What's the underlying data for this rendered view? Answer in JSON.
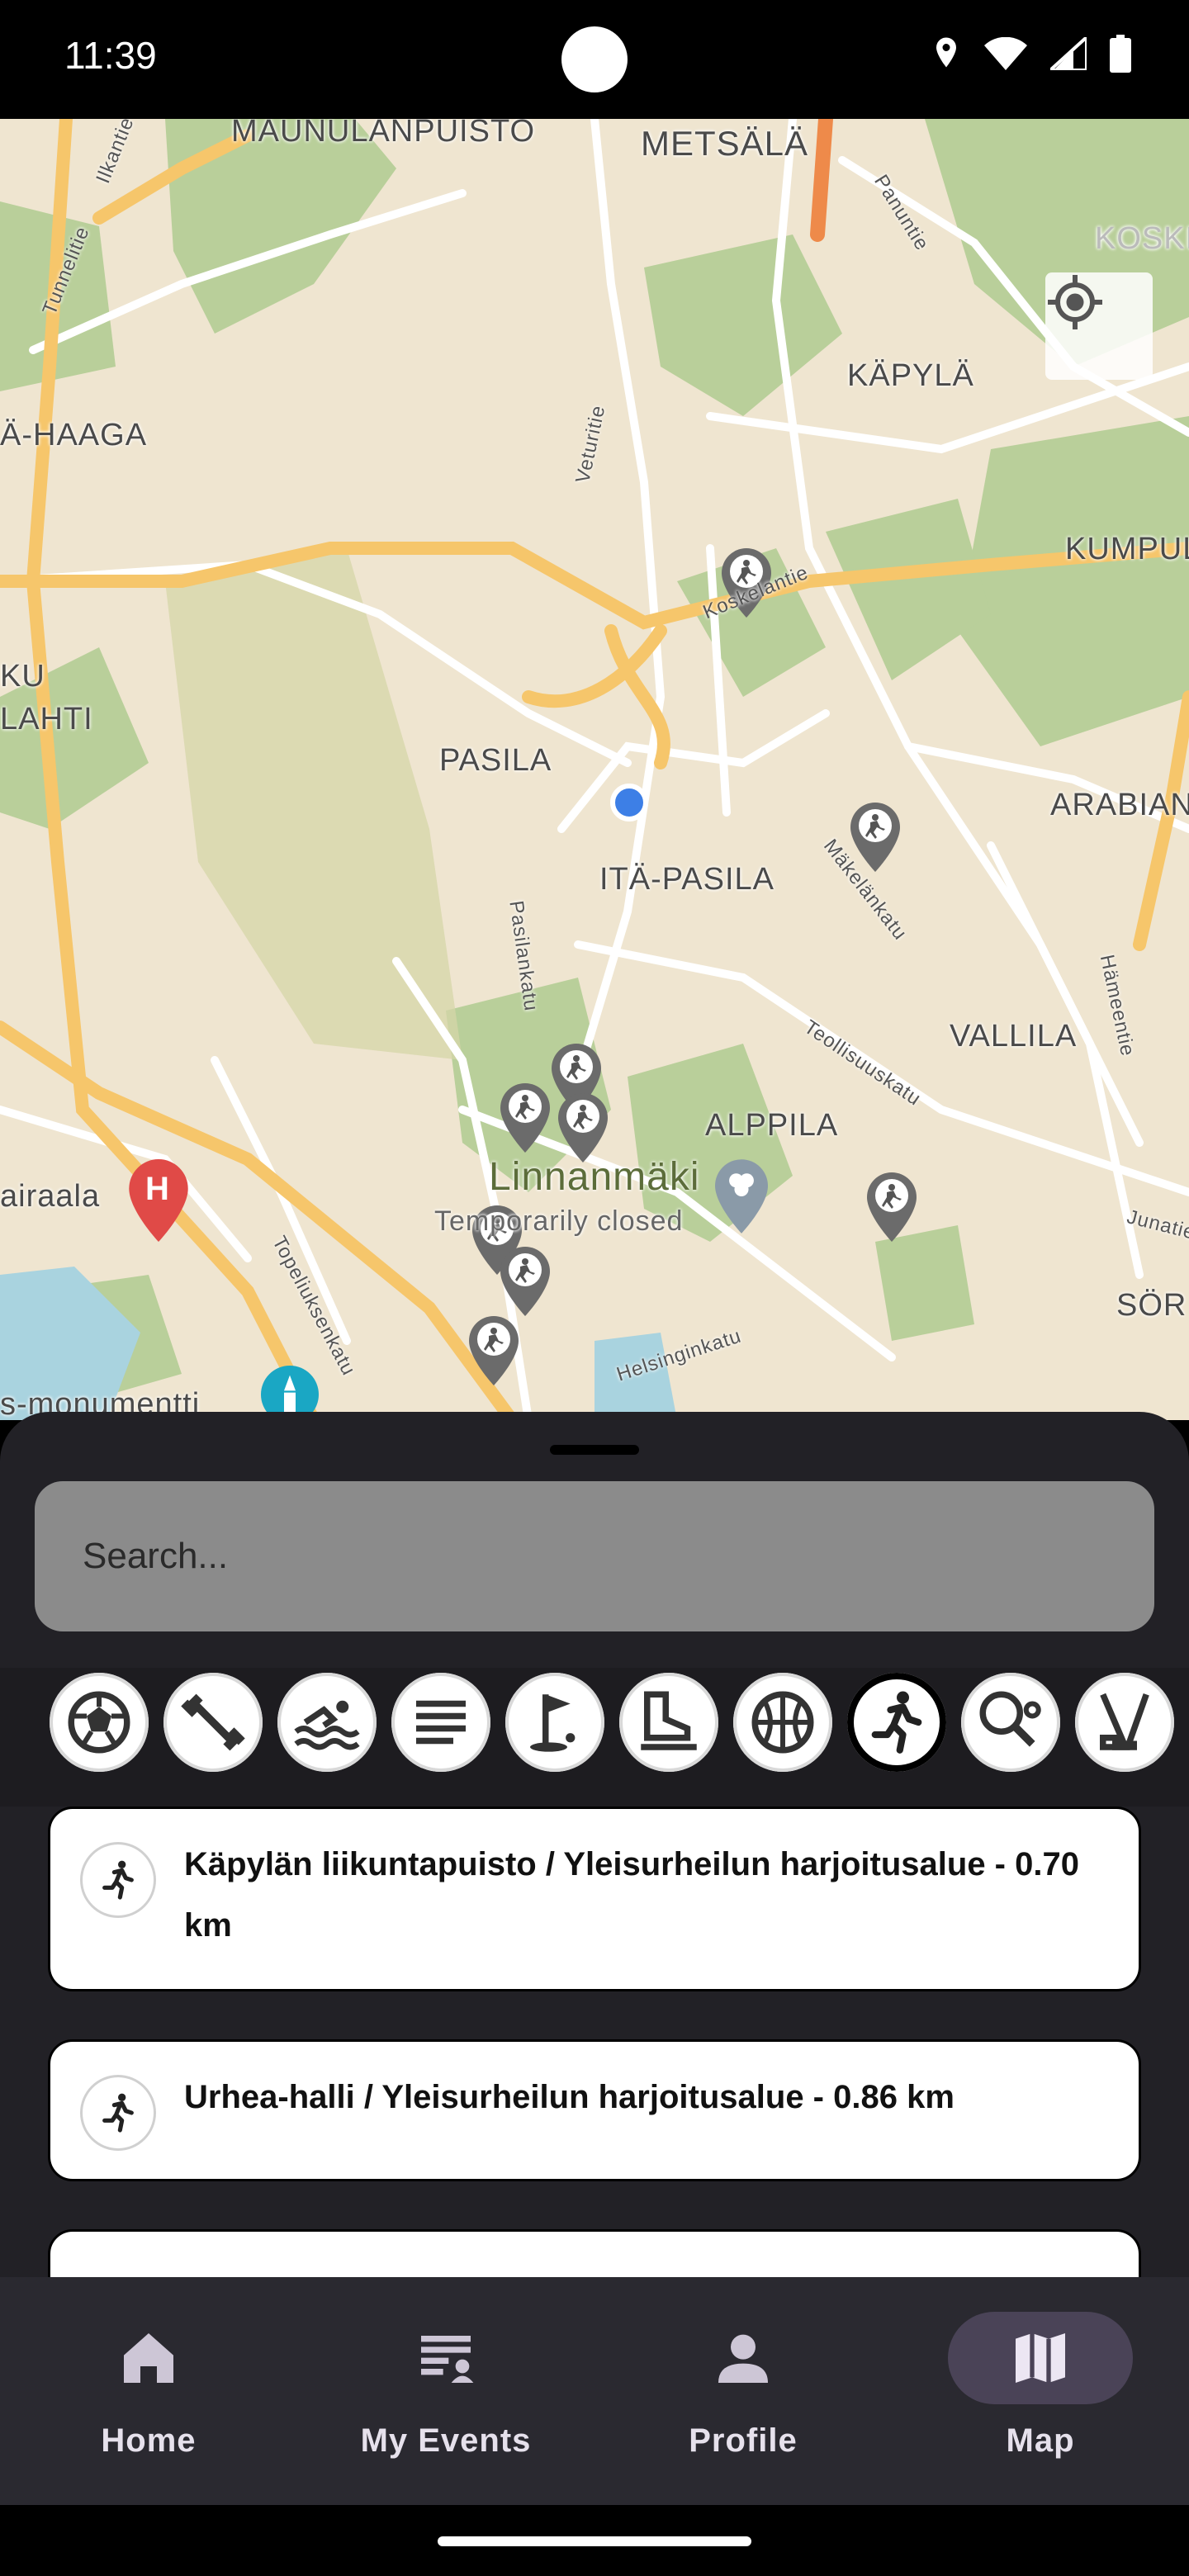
{
  "status_bar": {
    "time": "11:39"
  },
  "map": {
    "labels": {
      "maunulanpuisto": "MAUNULANPUISTO",
      "metsala": "METSÄLÄ",
      "kapyla": "KÄPYLÄ",
      "haaga": "Ä-HAAGA",
      "kumpula": "KUMPUL",
      "pasila": "PASILA",
      "ita_pasila": "ITÄ-PASILA",
      "arabia": "ARABIAN",
      "vallila": "VALLILA",
      "alppila": "ALPPILA",
      "linnanmaki": "Linnanmäki",
      "temporarily_closed": "Temporarily closed",
      "koski": "KOSKI",
      "ku": "KU",
      "lahti": "LAHTI",
      "sorn": "SÖR",
      "airaala": "airaala",
      "monumentti": "s-monumentti",
      "veturitie": "Veturitie",
      "pasilankatu": "Pasilankatu",
      "koskelantie": "Koskelantie",
      "makelankatu": "Mäkelänkatu",
      "teollisuuskatu": "Teollisuuskatu",
      "hameentie": "Hämeentie",
      "helsinginkatu": "Helsinginkatu",
      "topeliuksenkatu": "Topeliuksenkatu",
      "tunnelitie": "Tunnelitie",
      "ilkantie": "Ilkantie",
      "panuntie": "Panuntie",
      "junatie": "Junatie"
    },
    "hospital_letter": "H"
  },
  "search": {
    "placeholder": "Search..."
  },
  "categories": [
    {
      "icon": "soccer-ball-icon",
      "selected": false
    },
    {
      "icon": "dumbbell-icon",
      "selected": false
    },
    {
      "icon": "swimming-icon",
      "selected": false
    },
    {
      "icon": "list-icon",
      "selected": false
    },
    {
      "icon": "golf-icon",
      "selected": false
    },
    {
      "icon": "ice-skate-icon",
      "selected": false
    },
    {
      "icon": "basketball-icon",
      "selected": false
    },
    {
      "icon": "running-icon",
      "selected": true
    },
    {
      "icon": "tennis-racket-icon",
      "selected": false
    },
    {
      "icon": "hockey-icon",
      "selected": false
    }
  ],
  "results": [
    {
      "text": "Käpylän liikuntapuisto / Yleisurheilun harjoitusalue - 0.70 km",
      "icon": "running-icon"
    },
    {
      "text": "Urhea-halli / Yleisurheilun harjoitusalue - 0.86 km",
      "icon": "running-icon"
    }
  ],
  "nav": {
    "home": "Home",
    "my_events": "My Events",
    "profile": "Profile",
    "map": "Map",
    "active": "map"
  },
  "colors": {
    "accent_pill": "#4a4357",
    "map_bg": "#efe5d0",
    "park": "#b9cf9a",
    "road_major": "#f6c66b"
  }
}
